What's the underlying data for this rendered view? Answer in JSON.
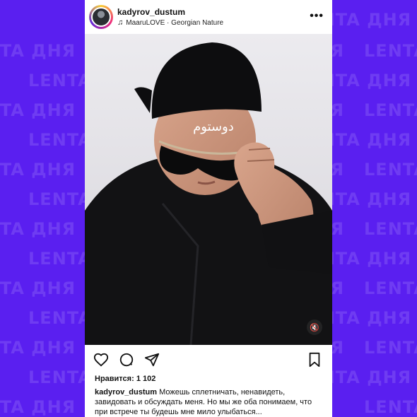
{
  "watermark": {
    "text": "LENTA ДНЯ"
  },
  "post": {
    "username": "kadyrov_dustum",
    "music": "MaaruLOVE · Georgian Nature",
    "more_icon": "more-horizontal-icon",
    "cap_text": "دوستوم",
    "likes_label": "Нравится:",
    "likes_count": "1 102",
    "caption_user": "kadyrov_dustum",
    "caption_text": "Можешь сплетничать, ненавидеть, завидовать и обсуждать меня. Но мы же оба понимаем, что при встрече ты будешь мне мило улыбаться..."
  },
  "colors": {
    "background": "#5a1ff0",
    "post_bg": "#ffffff"
  },
  "icons": [
    "heart-icon",
    "comment-icon",
    "share-icon",
    "bookmark-icon",
    "mute-icon",
    "music-icon"
  ]
}
